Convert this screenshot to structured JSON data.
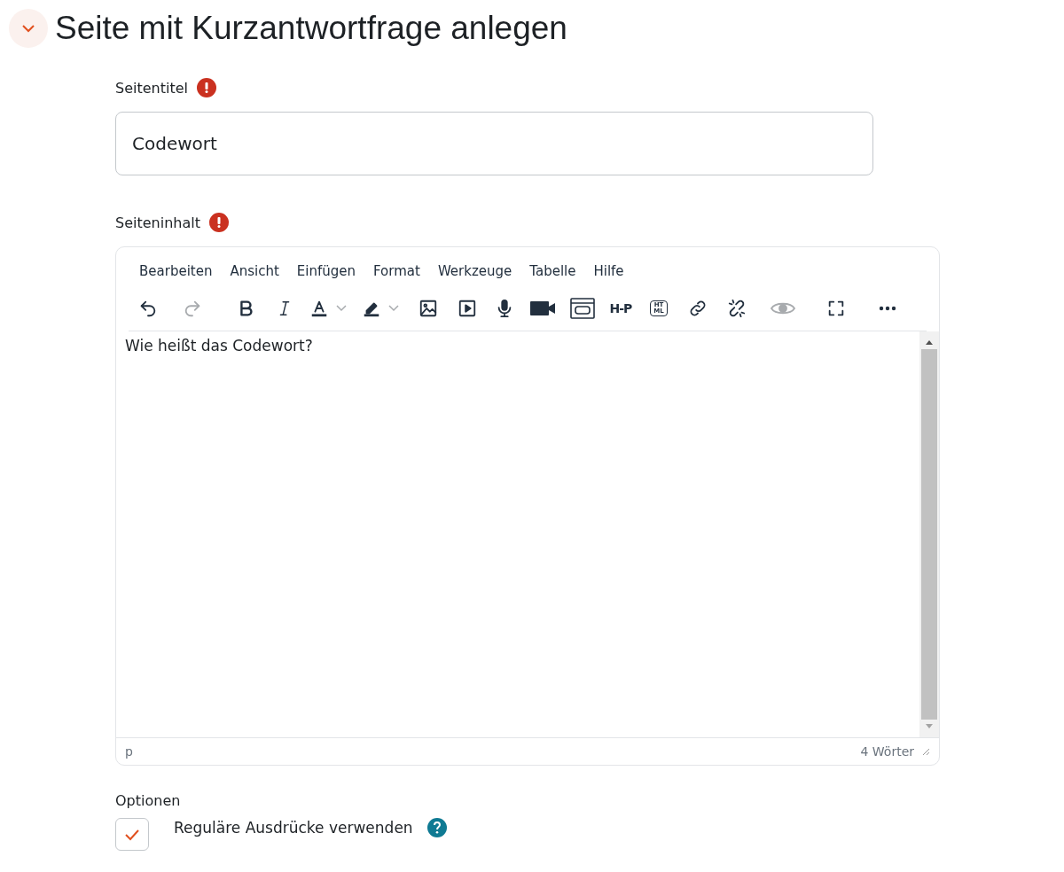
{
  "heading": {
    "title": "Seite mit Kurzantwortfrage anlegen",
    "expanded": true
  },
  "title_field": {
    "label": "Seitentitel",
    "required": true,
    "value": "Codewort"
  },
  "content_field": {
    "label": "Seiteninhalt",
    "required": true
  },
  "editor": {
    "menu": [
      "Bearbeiten",
      "Ansicht",
      "Einfügen",
      "Format",
      "Werkzeuge",
      "Tabelle",
      "Hilfe"
    ],
    "toolbar": [
      {
        "kind": "undo",
        "disabled": false
      },
      {
        "kind": "redo",
        "disabled": true
      },
      {
        "kind": "bold",
        "disabled": false
      },
      {
        "kind": "italic",
        "disabled": false
      },
      {
        "kind": "textcolor",
        "disabled": false
      },
      {
        "kind": "highlight",
        "disabled": false
      },
      {
        "kind": "image",
        "disabled": false
      },
      {
        "kind": "media",
        "disabled": false
      },
      {
        "kind": "mic",
        "disabled": false
      },
      {
        "kind": "camera",
        "disabled": false
      },
      {
        "kind": "embed",
        "disabled": false
      },
      {
        "kind": "label",
        "label": "H-P",
        "disabled": false
      },
      {
        "kind": "html",
        "label": "HTML",
        "disabled": false
      },
      {
        "kind": "link",
        "disabled": false
      },
      {
        "kind": "unlink",
        "disabled": false
      },
      {
        "kind": "eye",
        "disabled": true
      },
      {
        "kind": "fullscreen",
        "disabled": false
      },
      {
        "kind": "more",
        "disabled": false
      }
    ],
    "content": "Wie heißt das Codewort?",
    "path": "p",
    "word_count": "4 Wörter"
  },
  "options": {
    "title": "Optionen",
    "items": [
      {
        "label": "Reguläre Ausdrücke verwenden",
        "checked": true,
        "help": true
      }
    ]
  }
}
